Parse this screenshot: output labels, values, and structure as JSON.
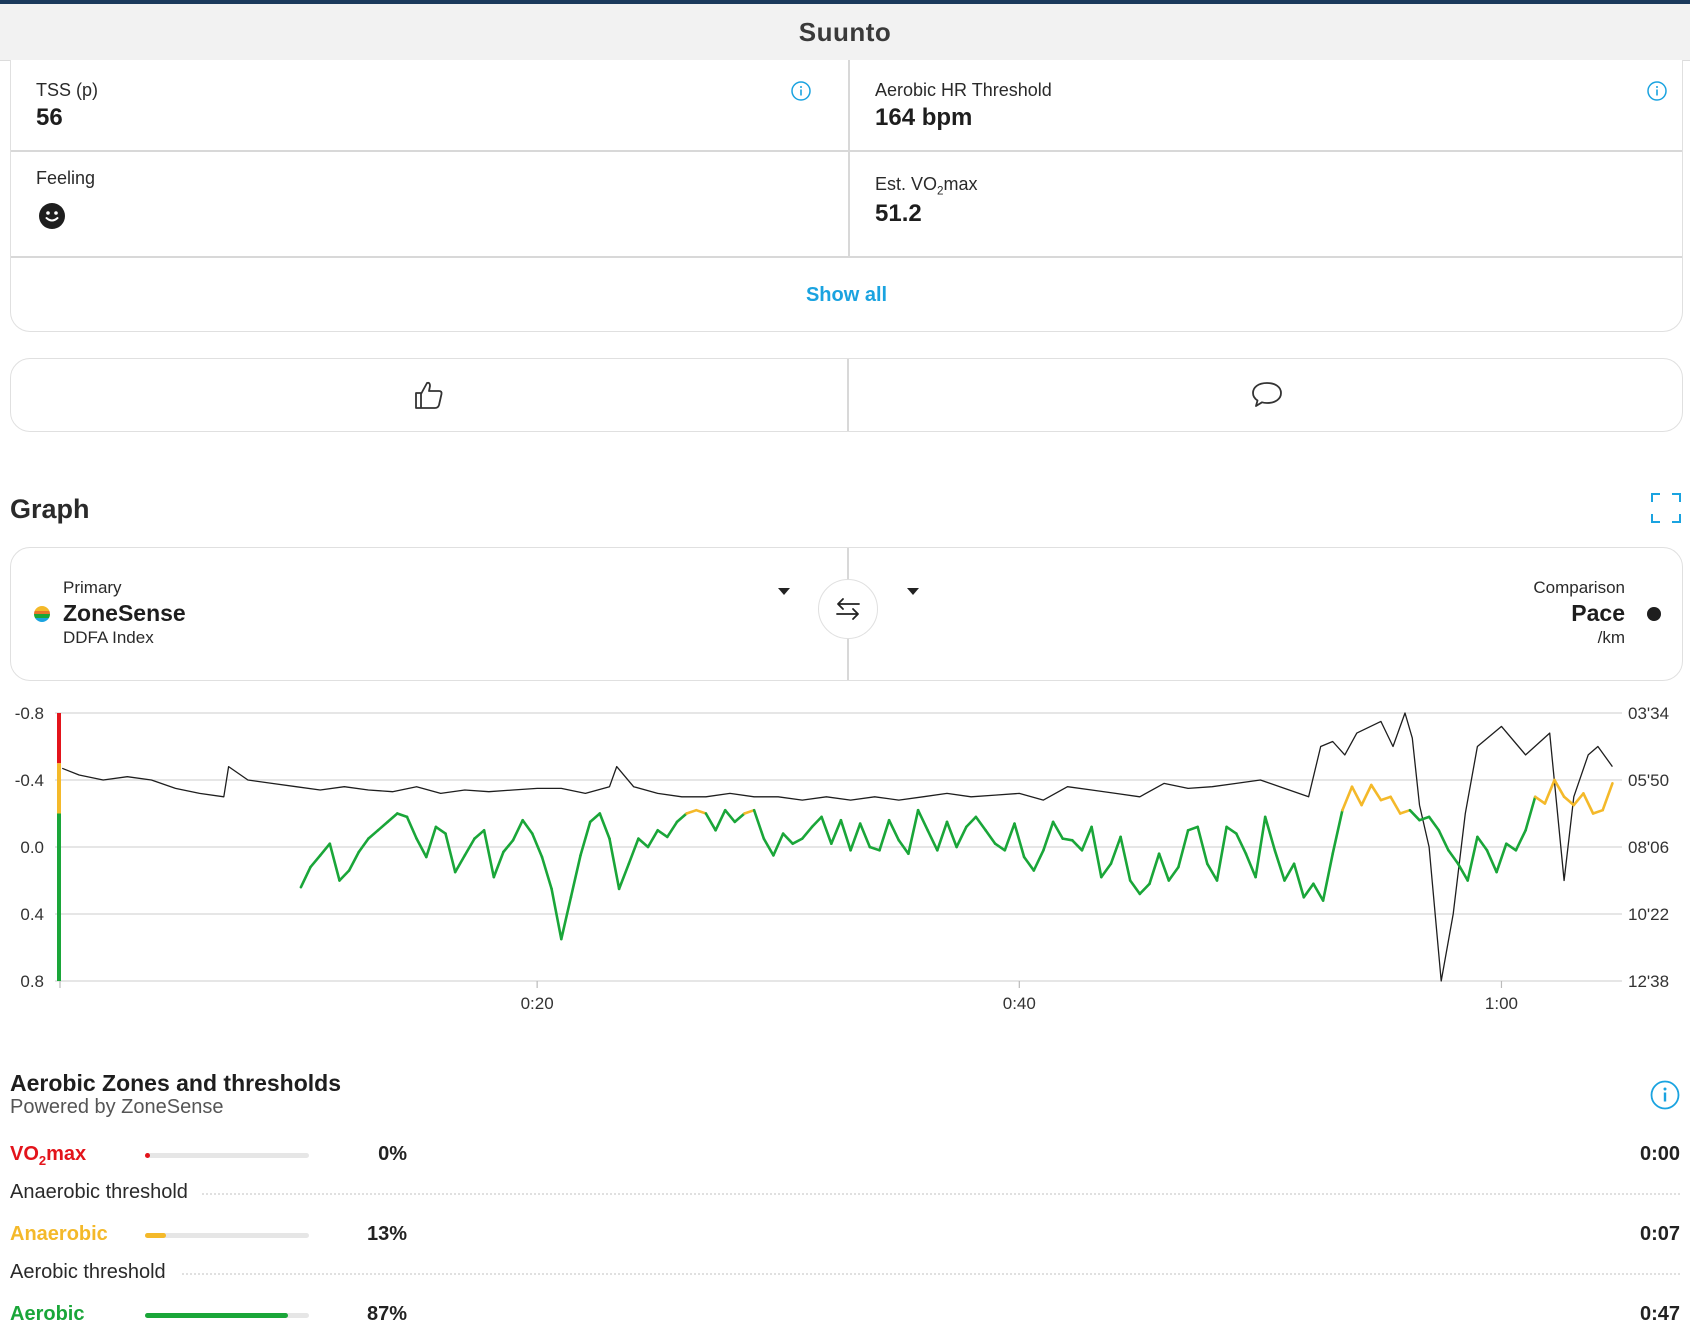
{
  "app": {
    "title": "Suunto"
  },
  "stats": {
    "tss": {
      "label": "TSS (p)",
      "value": "56"
    },
    "aerobic_hr": {
      "label": "Aerobic HR Threshold",
      "value": "164 bpm"
    },
    "feeling": {
      "label": "Feeling",
      "icon": "smiley-face-icon"
    },
    "vo2max": {
      "label_prefix": "Est. VO",
      "label_sub": "2",
      "label_suffix": "max",
      "value": "51.2"
    },
    "show_all": "Show all"
  },
  "social": {
    "like_icon": "thumbs-up-icon",
    "comment_icon": "comment-bubble-icon"
  },
  "graph": {
    "title": "Graph",
    "primary": {
      "caption": "Primary",
      "name": "ZoneSense",
      "sub": "DDFA Index"
    },
    "comparison": {
      "caption": "Comparison",
      "name": "Pace",
      "sub": "/km"
    }
  },
  "chart_data": {
    "type": "line",
    "x_ticks": [
      "0:20",
      "0:40",
      "1:00"
    ],
    "x_tick_minutes": [
      20,
      40,
      60
    ],
    "xlim_minutes": [
      0,
      65
    ],
    "left_axis": {
      "ticks": [
        "-0.8",
        "-0.4",
        "0.0",
        "0.4",
        "0.8"
      ],
      "ylim": [
        -0.8,
        0.8
      ],
      "inverted": true
    },
    "right_axis": {
      "ticks": [
        "03'34",
        "05'50",
        "08'06",
        "10'22",
        "12'38"
      ]
    },
    "zone_colors": {
      "vo2max": "#e3141b",
      "anaerobic": "#f4b92a",
      "aerobic": "#1aa639"
    },
    "zone_band": [
      {
        "from": -0.8,
        "to": -0.5,
        "color": "#e3141b"
      },
      {
        "from": -0.5,
        "to": -0.2,
        "color": "#f4b92a"
      },
      {
        "from": -0.2,
        "to": 0.8,
        "color": "#1aa639"
      }
    ],
    "anaerobic_threshold_ddfa": -0.2,
    "series": [
      {
        "role": "primary",
        "x": [
          10.2,
          10.6,
          11.0,
          11.4,
          11.8,
          12.2,
          12.6,
          13.0,
          13.4,
          13.8,
          14.2,
          14.6,
          15.0,
          15.4,
          15.8,
          16.2,
          16.6,
          17.0,
          17.4,
          17.8,
          18.2,
          18.6,
          19.0,
          19.4,
          19.8,
          20.2,
          20.6,
          21.0,
          21.4,
          21.8,
          22.2,
          22.6,
          23.0,
          23.4,
          23.8,
          24.2,
          24.6,
          25.0,
          25.4,
          25.8,
          26.2,
          26.6,
          27.0,
          27.4,
          27.8,
          28.2,
          28.6,
          29.0,
          29.4,
          29.8,
          30.2,
          30.6,
          31.0,
          31.4,
          31.8,
          32.2,
          32.6,
          33.0,
          33.4,
          33.8,
          34.2,
          34.6,
          35.0,
          35.4,
          35.8,
          36.2,
          36.6,
          37.0,
          37.4,
          37.8,
          38.2,
          38.6,
          39.0,
          39.4,
          39.8,
          40.2,
          40.6,
          41.0,
          41.4,
          41.8,
          42.2,
          42.6,
          43.0,
          43.4,
          43.8,
          44.2,
          44.6,
          45.0,
          45.4,
          45.8,
          46.2,
          46.6,
          47.0,
          47.4,
          47.8,
          48.2,
          48.6,
          49.0,
          49.4,
          49.8,
          50.2,
          50.6,
          51.0,
          51.4,
          51.8,
          52.2,
          52.6,
          53.0,
          53.4,
          53.8,
          54.2,
          54.6,
          55.0,
          55.4,
          55.8,
          56.2,
          56.6,
          57.0,
          57.4,
          57.8,
          58.2,
          58.6,
          59.0,
          59.4,
          59.8,
          60.2,
          60.6,
          61.0,
          61.4,
          61.8,
          62.2,
          62.6,
          63.0,
          63.4,
          63.8,
          64.2,
          64.6
        ],
        "y": [
          0.24,
          0.12,
          0.05,
          -0.02,
          0.2,
          0.14,
          0.03,
          -0.05,
          -0.1,
          -0.15,
          -0.2,
          -0.18,
          -0.05,
          0.06,
          -0.12,
          -0.08,
          0.15,
          0.05,
          -0.05,
          -0.1,
          0.18,
          0.03,
          -0.04,
          -0.16,
          -0.08,
          0.06,
          0.25,
          0.55,
          0.3,
          0.05,
          -0.15,
          -0.2,
          -0.05,
          0.25,
          0.1,
          -0.05,
          0.0,
          -0.1,
          -0.06,
          -0.15,
          -0.2,
          -0.22,
          -0.2,
          -0.1,
          -0.22,
          -0.15,
          -0.2,
          -0.22,
          -0.05,
          0.05,
          -0.08,
          -0.02,
          -0.05,
          -0.12,
          -0.18,
          -0.02,
          -0.16,
          0.02,
          -0.14,
          0.0,
          0.02,
          -0.16,
          -0.04,
          0.04,
          -0.22,
          -0.1,
          0.02,
          -0.15,
          0.0,
          -0.12,
          -0.18,
          -0.1,
          -0.02,
          0.02,
          -0.14,
          0.06,
          0.14,
          0.02,
          -0.15,
          -0.05,
          -0.04,
          0.02,
          -0.12,
          0.18,
          0.1,
          -0.06,
          0.2,
          0.28,
          0.22,
          0.04,
          0.2,
          0.12,
          -0.1,
          -0.12,
          0.1,
          0.2,
          -0.12,
          -0.08,
          0.04,
          0.18,
          -0.18,
          0.02,
          0.2,
          0.1,
          0.3,
          0.22,
          0.32,
          0.04,
          -0.22,
          -0.36,
          -0.25,
          -0.37,
          -0.28,
          -0.3,
          -0.2,
          -0.22,
          -0.16,
          -0.18,
          -0.1,
          0.02,
          0.1,
          0.2,
          -0.06,
          0.02,
          0.15,
          -0.02,
          0.02,
          -0.1,
          -0.3,
          -0.26,
          -0.4,
          -0.3,
          -0.25,
          -0.32,
          -0.2,
          -0.22,
          -0.38
        ]
      },
      {
        "role": "comparison",
        "x": [
          0.3,
          1.0,
          2.0,
          3.0,
          4.0,
          5.0,
          6.0,
          7.0,
          7.2,
          8.0,
          9.0,
          10.0,
          11.0,
          12.0,
          13.0,
          14.0,
          15.0,
          16.0,
          17.0,
          18.0,
          19.0,
          20.0,
          21.0,
          22.0,
          23.0,
          23.3,
          24.0,
          25.0,
          26.0,
          27.0,
          28.0,
          29.0,
          30.0,
          31.0,
          32.0,
          33.0,
          34.0,
          35.0,
          36.0,
          37.0,
          38.0,
          39.0,
          40.0,
          41.0,
          42.0,
          43.0,
          44.0,
          45.0,
          46.0,
          47.0,
          48.0,
          49.0,
          50.0,
          51.0,
          52.0,
          52.5,
          53.0,
          53.5,
          54.0,
          55.0,
          55.5,
          56.0,
          56.3,
          56.6,
          57.0,
          57.5,
          58.0,
          58.5,
          59.0,
          60.0,
          61.0,
          62.0,
          62.6,
          63.0,
          63.6,
          64.0,
          64.6
        ],
        "y": [
          -0.47,
          -0.43,
          -0.4,
          -0.42,
          -0.4,
          -0.35,
          -0.32,
          -0.3,
          -0.48,
          -0.4,
          -0.38,
          -0.36,
          -0.34,
          -0.36,
          -0.34,
          -0.33,
          -0.36,
          -0.32,
          -0.34,
          -0.33,
          -0.34,
          -0.35,
          -0.35,
          -0.32,
          -0.36,
          -0.48,
          -0.36,
          -0.32,
          -0.3,
          -0.3,
          -0.32,
          -0.3,
          -0.3,
          -0.28,
          -0.3,
          -0.28,
          -0.3,
          -0.28,
          -0.3,
          -0.32,
          -0.3,
          -0.31,
          -0.32,
          -0.28,
          -0.36,
          -0.34,
          -0.32,
          -0.3,
          -0.38,
          -0.35,
          -0.36,
          -0.38,
          -0.4,
          -0.35,
          -0.3,
          -0.6,
          -0.63,
          -0.55,
          -0.68,
          -0.75,
          -0.6,
          -0.8,
          -0.65,
          -0.25,
          0.0,
          0.8,
          0.4,
          -0.2,
          -0.6,
          -0.72,
          -0.55,
          -0.68,
          0.2,
          -0.3,
          -0.55,
          -0.6,
          -0.48
        ]
      }
    ]
  },
  "zones": {
    "title": "Aerobic Zones and thresholds",
    "subtitle": "Powered by ZoneSense",
    "rows": [
      {
        "type": "zone",
        "name_main": "VO",
        "name_sub": "2",
        "name_suffix": "max",
        "color": "#e3141b",
        "percent": "0%",
        "fraction": 0.0,
        "time": "0:00"
      },
      {
        "type": "threshold",
        "label": "Anaerobic threshold"
      },
      {
        "type": "zone",
        "name_main": "Anaerobic",
        "name_sub": "",
        "name_suffix": "",
        "color": "#f4b92a",
        "percent": "13%",
        "fraction": 0.13,
        "time": "0:07"
      },
      {
        "type": "threshold",
        "label": "Aerobic threshold"
      },
      {
        "type": "zone",
        "name_main": "Aerobic",
        "name_sub": "",
        "name_suffix": "",
        "color": "#1aa639",
        "percent": "87%",
        "fraction": 0.87,
        "time": "0:47"
      }
    ]
  }
}
